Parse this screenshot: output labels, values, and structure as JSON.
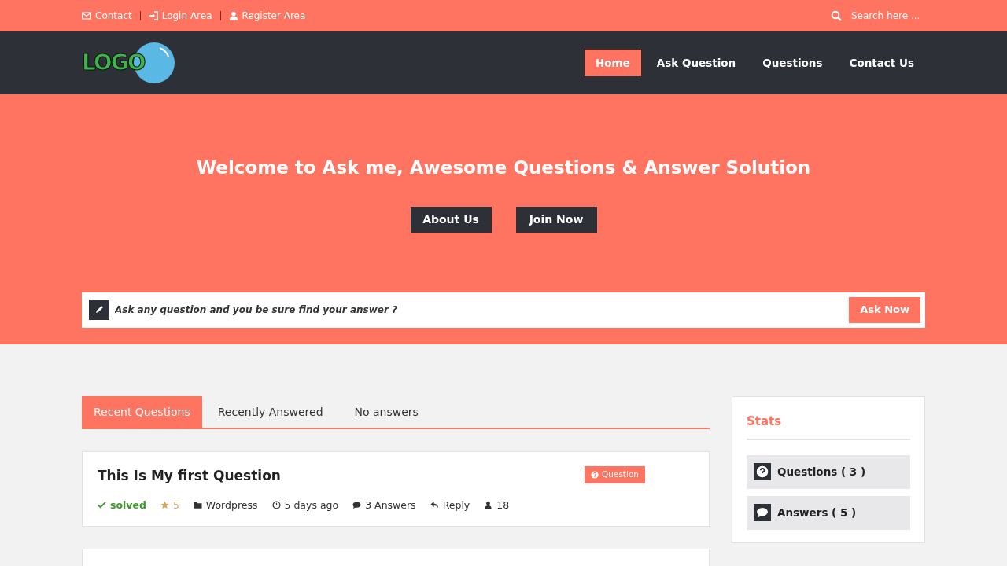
{
  "top_bar": {
    "links": [
      {
        "kind": "mail",
        "label": "Contact"
      },
      {
        "kind": "login",
        "label": "Login Area"
      },
      {
        "kind": "user",
        "label": "Register Area"
      }
    ],
    "search": {
      "placeholder": "Search here ..."
    }
  },
  "header": {
    "logo": "LOGO",
    "nav": [
      {
        "label": "Home",
        "selected": true
      },
      {
        "label": "Ask Question",
        "selected": false
      },
      {
        "label": "Questions",
        "selected": false
      },
      {
        "label": "Contact Us",
        "selected": false
      }
    ]
  },
  "hero": {
    "title": "Welcome to Ask me, Awesome Questions & Answer Solution",
    "buttons": [
      "About Us",
      "Join Now"
    ],
    "ask": {
      "placeholder": "Ask any question and you be sure find your answer ?",
      "button": "Ask Now"
    }
  },
  "tabs": [
    {
      "label": "Recent Questions",
      "selected": true
    },
    {
      "label": "Recently Answered",
      "selected": false
    },
    {
      "label": "No answers",
      "selected": false
    }
  ],
  "questions": [
    {
      "title": "This Is My first Question",
      "tag": "Question",
      "meta": [
        {
          "kind": "solved",
          "text": "solved"
        },
        {
          "kind": "rating",
          "text": "5"
        },
        {
          "kind": "category",
          "text": "Wordpress"
        },
        {
          "kind": "time",
          "text": "5 days ago"
        },
        {
          "kind": "answers",
          "text": "3 Answers"
        },
        {
          "kind": "reply",
          "text": "Reply"
        },
        {
          "kind": "views",
          "text": "18"
        }
      ]
    }
  ],
  "stats": {
    "title": "Stats",
    "items": [
      {
        "kind": "questions",
        "label": "Questions ( 3 )"
      },
      {
        "kind": "answers",
        "label": "Answers ( 5 )"
      }
    ]
  }
}
